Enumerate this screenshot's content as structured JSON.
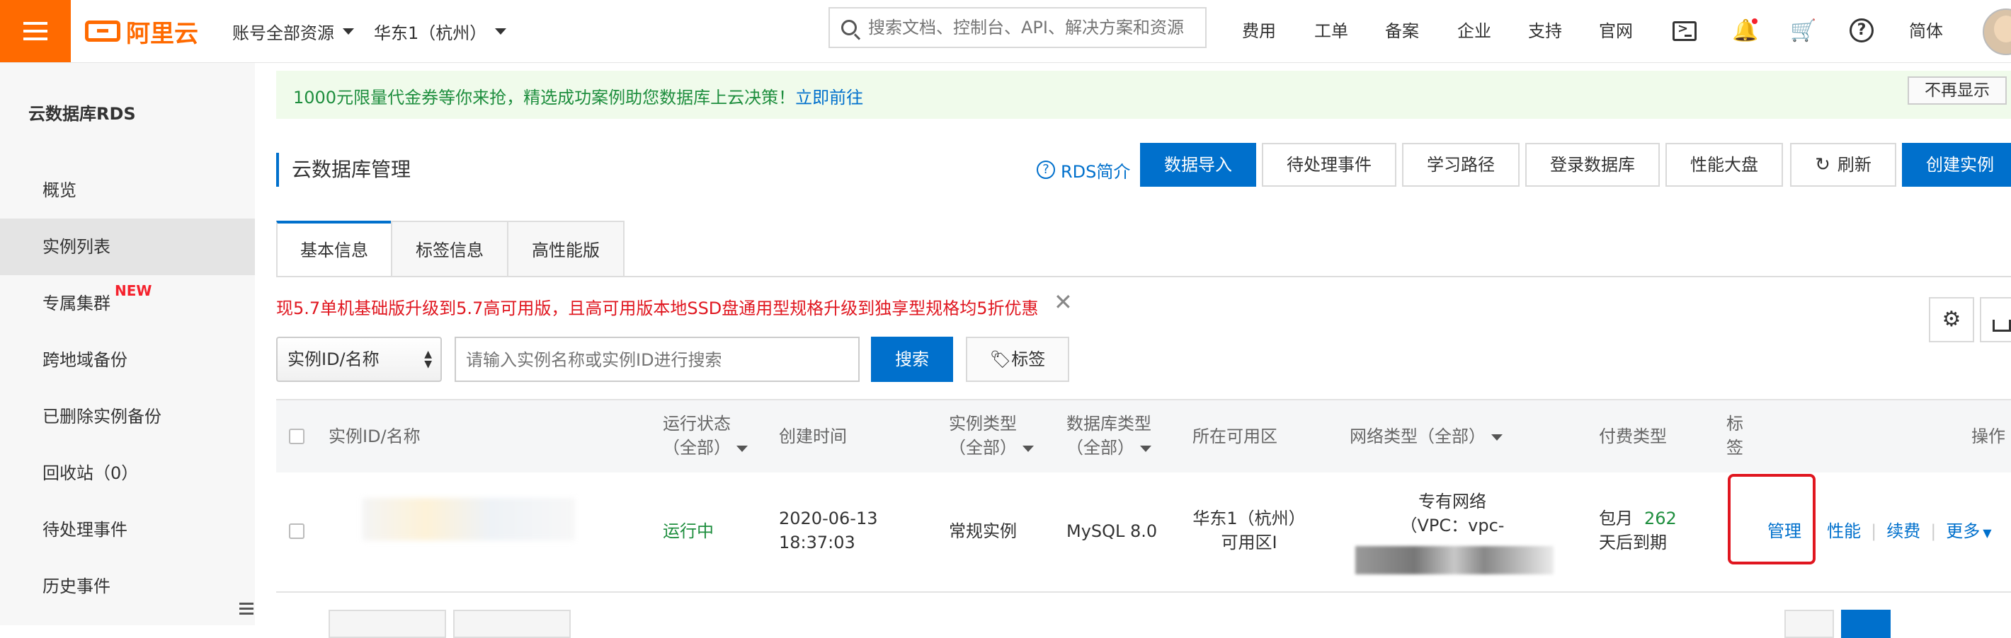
{
  "topbar": {
    "brand": "阿里云",
    "account_scope": "账号全部资源",
    "region": "华东1（杭州）",
    "search_placeholder": "搜索文档、控制台、API、解决方案和资源",
    "links": [
      "费用",
      "工单",
      "备案",
      "企业",
      "支持",
      "官网"
    ],
    "language": "简体",
    "icons": [
      "menu-icon",
      "terminal-icon",
      "bell-icon",
      "cart-icon",
      "help-icon"
    ]
  },
  "sidebar": {
    "title": "云数据库RDS",
    "items": [
      {
        "label": "概览"
      },
      {
        "label": "实例列表",
        "active": true
      },
      {
        "label": "专属集群",
        "badge": "NEW"
      },
      {
        "label": "跨地域备份"
      },
      {
        "label": "已删除实例备份"
      },
      {
        "label": "回收站（0）"
      },
      {
        "label": "待处理事件"
      },
      {
        "label": "历史事件"
      }
    ]
  },
  "banner": {
    "text": "1000元限量代金券等你来抢，精选成功案例助您数据库上云决策！",
    "link": "立即前往",
    "dismiss": "不再显示"
  },
  "header": {
    "title": "云数据库管理",
    "intro_link": "RDS简介",
    "buttons": {
      "import": "数据导入",
      "pending": "待处理事件",
      "learning": "学习路径",
      "login": "登录数据库",
      "dashboard": "性能大盘",
      "refresh": "刷新",
      "create": "创建实例"
    }
  },
  "tabs": [
    "基本信息",
    "标签信息",
    "高性能版"
  ],
  "promo": "现5.7单机基础版升级到5.7高可用版，且高可用版本地SSD盘通用型规格升级到独享型规格均5折优惠",
  "filter": {
    "select_value": "实例ID/名称",
    "input_placeholder": "请输入实例名称或实例ID进行搜索",
    "search_label": "搜索",
    "tag_label": "标签"
  },
  "table": {
    "headers": {
      "id": "实例ID/名称",
      "status_1": "运行状态",
      "status_2": "（全部）",
      "created": "创建时间",
      "type_1": "实例类型",
      "type_2": "（全部）",
      "db_1": "数据库类型",
      "db_2": "（全部）",
      "zone": "所在可用区",
      "network": "网络类型（全部）",
      "billing": "付费类型",
      "tag_1": "标",
      "tag_2": "签",
      "actions": "操作"
    },
    "rows": [
      {
        "status": "运行中",
        "created_date": "2020-06-13",
        "created_time": "18:37:03",
        "instance_type": "常规实例",
        "db_type": "MySQL 8.0",
        "zone_1": "华东1（杭州）",
        "zone_2": "可用区I",
        "network_1": "专有网络",
        "network_2": "（VPC：vpc-",
        "billing_1": "包月",
        "billing_days": "262",
        "billing_2": "天后到期",
        "actions": {
          "manage": "管理",
          "perf": "性能",
          "renew": "续费",
          "more": "更多"
        }
      }
    ]
  },
  "colors": {
    "brand": "#ff6a00",
    "primary": "#0070cc",
    "running": "#1e8e3e",
    "alert": "#e0161f"
  }
}
